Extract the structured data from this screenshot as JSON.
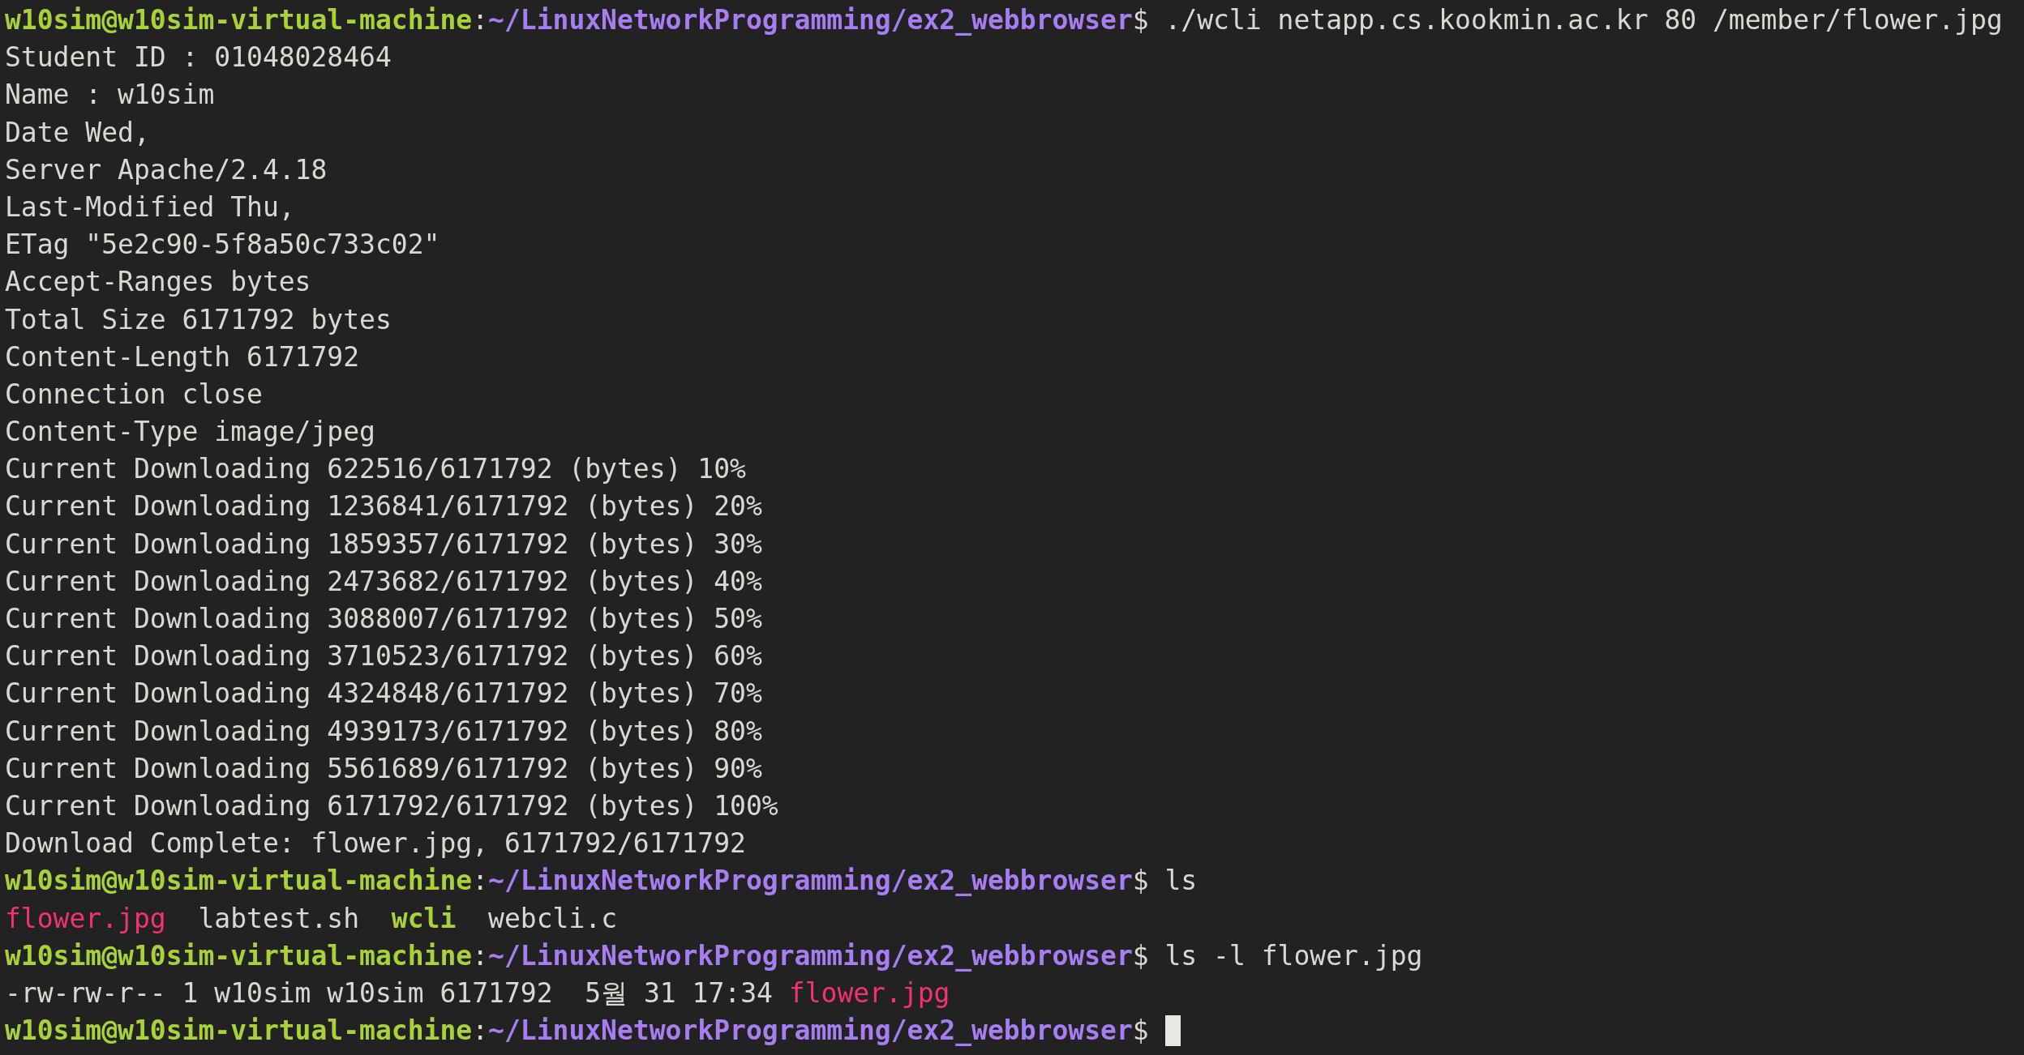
{
  "terminal": {
    "lines": [
      [
        {
          "kind": "user_host",
          "text": "w10sim@w10sim-virtual-machine"
        },
        {
          "kind": "text",
          "text": ":"
        },
        {
          "kind": "path",
          "text": "~/LinuxNetworkProgramming/ex2_webbrowser"
        },
        {
          "kind": "text",
          "text": "$ ./wcli netapp.cs.kookmin.ac.kr 80 /member/flower.jpg"
        }
      ],
      [
        {
          "kind": "text",
          "text": "Student ID : 01048028464"
        }
      ],
      [
        {
          "kind": "text",
          "text": "Name : w10sim"
        }
      ],
      [
        {
          "kind": "text",
          "text": "Date Wed,"
        }
      ],
      [
        {
          "kind": "text",
          "text": "Server Apache/2.4.18"
        }
      ],
      [
        {
          "kind": "text",
          "text": "Last-Modified Thu,"
        }
      ],
      [
        {
          "kind": "text",
          "text": "ETag \"5e2c90-5f8a50c733c02\""
        }
      ],
      [
        {
          "kind": "text",
          "text": "Accept-Ranges bytes"
        }
      ],
      [
        {
          "kind": "text",
          "text": "Total Size 6171792 bytes"
        }
      ],
      [
        {
          "kind": "text",
          "text": "Content-Length 6171792"
        }
      ],
      [
        {
          "kind": "text",
          "text": "Connection close"
        }
      ],
      [
        {
          "kind": "text",
          "text": "Content-Type image/jpeg"
        }
      ],
      [
        {
          "kind": "text",
          "text": "Current Downloading 622516/6171792 (bytes) 10%"
        }
      ],
      [
        {
          "kind": "text",
          "text": "Current Downloading 1236841/6171792 (bytes) 20%"
        }
      ],
      [
        {
          "kind": "text",
          "text": "Current Downloading 1859357/6171792 (bytes) 30%"
        }
      ],
      [
        {
          "kind": "text",
          "text": "Current Downloading 2473682/6171792 (bytes) 40%"
        }
      ],
      [
        {
          "kind": "text",
          "text": "Current Downloading 3088007/6171792 (bytes) 50%"
        }
      ],
      [
        {
          "kind": "text",
          "text": "Current Downloading 3710523/6171792 (bytes) 60%"
        }
      ],
      [
        {
          "kind": "text",
          "text": "Current Downloading 4324848/6171792 (bytes) 70%"
        }
      ],
      [
        {
          "kind": "text",
          "text": "Current Downloading 4939173/6171792 (bytes) 80%"
        }
      ],
      [
        {
          "kind": "text",
          "text": "Current Downloading 5561689/6171792 (bytes) 90%"
        }
      ],
      [
        {
          "kind": "text",
          "text": "Current Downloading 6171792/6171792 (bytes) 100%"
        }
      ],
      [
        {
          "kind": "text",
          "text": "Download Complete: flower.jpg, 6171792/6171792"
        }
      ],
      [
        {
          "kind": "user_host",
          "text": "w10sim@w10sim-virtual-machine"
        },
        {
          "kind": "text",
          "text": ":"
        },
        {
          "kind": "path",
          "text": "~/LinuxNetworkProgramming/ex2_webbrowser"
        },
        {
          "kind": "text",
          "text": "$ ls"
        }
      ],
      [
        {
          "kind": "image_file",
          "text": "flower.jpg"
        },
        {
          "kind": "text",
          "text": "  labtest.sh  "
        },
        {
          "kind": "exec_file",
          "text": "wcli"
        },
        {
          "kind": "text",
          "text": "  webcli.c"
        }
      ],
      [
        {
          "kind": "user_host",
          "text": "w10sim@w10sim-virtual-machine"
        },
        {
          "kind": "text",
          "text": ":"
        },
        {
          "kind": "path",
          "text": "~/LinuxNetworkProgramming/ex2_webbrowser"
        },
        {
          "kind": "text",
          "text": "$ ls -l flower.jpg"
        }
      ],
      [
        {
          "kind": "text",
          "text": "-rw-rw-r-- 1 w10sim w10sim 6171792  5월 31 17:34 "
        },
        {
          "kind": "image_file",
          "text": "flower.jpg"
        }
      ],
      [
        {
          "kind": "user_host",
          "text": "w10sim@w10sim-virtual-machine"
        },
        {
          "kind": "text",
          "text": ":"
        },
        {
          "kind": "path",
          "text": "~/LinuxNetworkProgramming/ex2_webbrowser"
        },
        {
          "kind": "text",
          "text": "$ "
        },
        {
          "kind": "cursor"
        }
      ]
    ]
  }
}
